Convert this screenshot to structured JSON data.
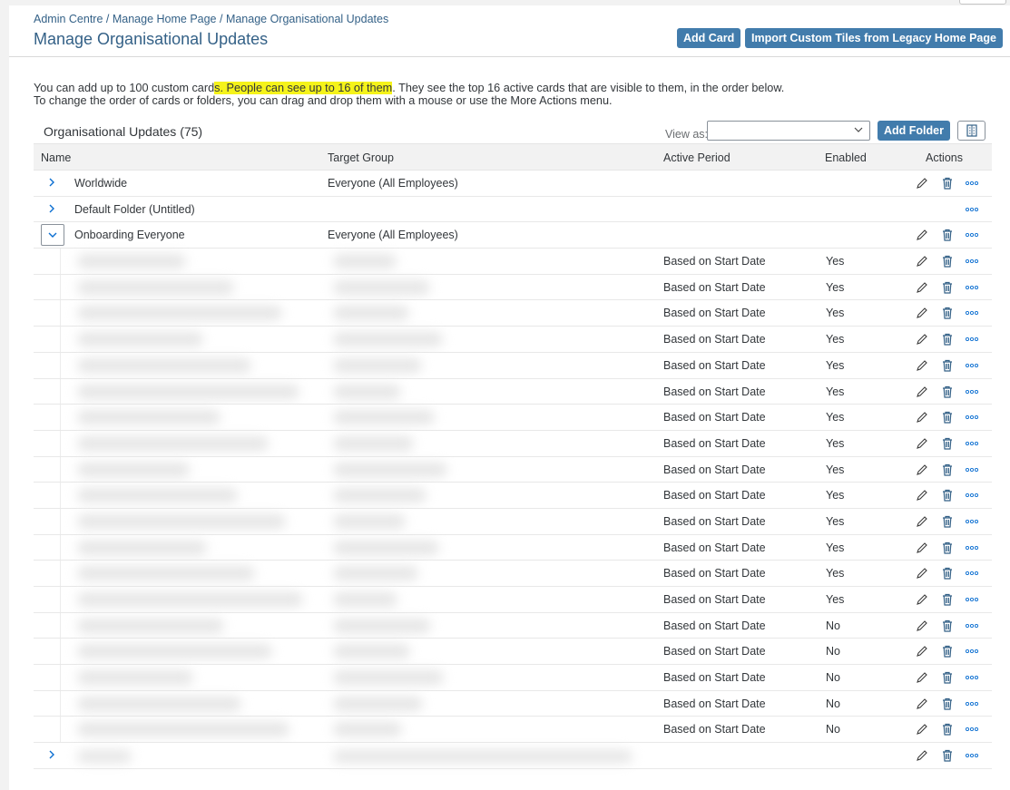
{
  "breadcrumb": {
    "items": [
      "Admin Centre",
      "Manage Home Page",
      "Manage Organisational Updates"
    ],
    "separator": " / "
  },
  "page_title": "Manage Organisational Updates",
  "toolbar": {
    "add_card_label": "Add Card",
    "import_label": "Import Custom Tiles from Legacy Home Page"
  },
  "info": {
    "line1_part1": "You can add up to 100 custom card",
    "line1_highlight": "s. People can see up to 16 of them",
    "line1_part2": ". They see the top 16 active cards that are visible to them, in the order below.",
    "line2": "To change the order of cards or folders, you can drag and drop them with a mouse or use the More Actions menu."
  },
  "table_controls": {
    "title": "Organisational Updates (75)",
    "view_as_label": "View as:",
    "view_as_value": "",
    "add_folder_label": "Add Folder"
  },
  "columns": {
    "name": "Name",
    "target_group": "Target Group",
    "active_period": "Active Period",
    "enabled": "Enabled",
    "actions": "Actions"
  },
  "folders": [
    {
      "name": "Worldwide",
      "target_group": "Everyone (All Employees)",
      "expanded": false
    },
    {
      "name": "Default Folder (Untitled)",
      "target_group": "",
      "expanded": false
    },
    {
      "name": "Onboarding Everyone",
      "target_group": "Everyone (All Employees)",
      "expanded": true
    }
  ],
  "cards": [
    {
      "active_period": "Based on Start Date",
      "enabled": "Yes"
    },
    {
      "active_period": "Based on Start Date",
      "enabled": "Yes"
    },
    {
      "active_period": "Based on Start Date",
      "enabled": "Yes"
    },
    {
      "active_period": "Based on Start Date",
      "enabled": "Yes"
    },
    {
      "active_period": "Based on Start Date",
      "enabled": "Yes"
    },
    {
      "active_period": "Based on Start Date",
      "enabled": "Yes"
    },
    {
      "active_period": "Based on Start Date",
      "enabled": "Yes"
    },
    {
      "active_period": "Based on Start Date",
      "enabled": "Yes"
    },
    {
      "active_period": "Based on Start Date",
      "enabled": "Yes"
    },
    {
      "active_period": "Based on Start Date",
      "enabled": "Yes"
    },
    {
      "active_period": "Based on Start Date",
      "enabled": "Yes"
    },
    {
      "active_period": "Based on Start Date",
      "enabled": "Yes"
    },
    {
      "active_period": "Based on Start Date",
      "enabled": "Yes"
    },
    {
      "active_period": "Based on Start Date",
      "enabled": "Yes"
    },
    {
      "active_period": "Based on Start Date",
      "enabled": "No"
    },
    {
      "active_period": "Based on Start Date",
      "enabled": "No"
    },
    {
      "active_period": "Based on Start Date",
      "enabled": "No"
    },
    {
      "active_period": "Based on Start Date",
      "enabled": "No"
    },
    {
      "active_period": "Based on Start Date",
      "enabled": "No"
    }
  ],
  "colors": {
    "accent": "#427cac",
    "link": "#346187",
    "highlight": "#f5f31a"
  },
  "icons": {
    "expand": "chevron-right-icon",
    "collapse": "chevron-down-icon",
    "edit": "pencil-icon",
    "delete": "trash-icon",
    "more": "more-actions-icon",
    "settings": "table-settings-icon"
  }
}
